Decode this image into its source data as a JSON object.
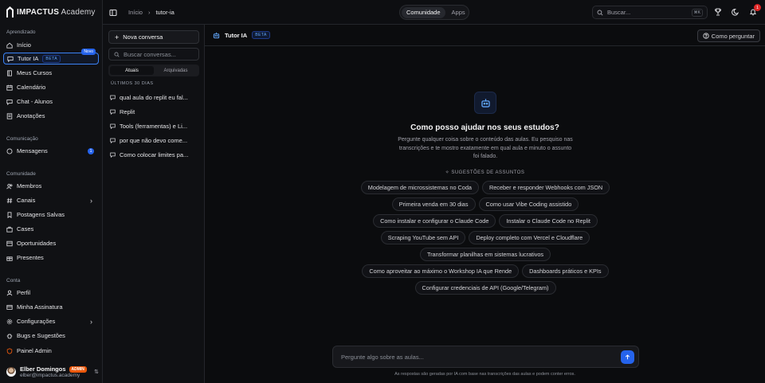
{
  "brand": {
    "name": "IMPACTUS",
    "suffix": " Academy"
  },
  "sidebar": {
    "sections": [
      {
        "label": "Aprendizado"
      },
      {
        "label": "Comunicação"
      },
      {
        "label": "Comunidade"
      },
      {
        "label": "Conta"
      }
    ],
    "items": [
      {
        "label": "Início",
        "icon": "home-icon"
      },
      {
        "label": "Tutor IA",
        "icon": "chat-icon",
        "badge": "BETA",
        "tag": "Novo",
        "active": true
      },
      {
        "label": "Meus Cursos",
        "icon": "book-icon"
      },
      {
        "label": "Calendário",
        "icon": "calendar-icon"
      },
      {
        "label": "Chat - Alunos",
        "icon": "chat-icon"
      },
      {
        "label": "Anotações",
        "icon": "note-icon"
      },
      {
        "label": "Mensagens",
        "icon": "message-icon",
        "count": "1"
      },
      {
        "label": "Membros",
        "icon": "users-icon"
      },
      {
        "label": "Canais",
        "icon": "hash-icon"
      },
      {
        "label": "Postagens Salvas",
        "icon": "bookmark-icon"
      },
      {
        "label": "Cases",
        "icon": "briefcase-icon"
      },
      {
        "label": "Oportunidades",
        "icon": "target-icon"
      },
      {
        "label": "Presentes",
        "icon": "gift-icon"
      },
      {
        "label": "Perfil",
        "icon": "user-icon"
      },
      {
        "label": "Minha Assinatura",
        "icon": "card-icon"
      },
      {
        "label": "Configurações",
        "icon": "gear-icon"
      },
      {
        "label": "Bugs e Sugestões",
        "icon": "bug-icon"
      },
      {
        "label": "Painel Admin",
        "icon": "shield-icon"
      }
    ],
    "user": {
      "name": "Elber Domingos",
      "role": "ADMIN",
      "email": "elber@impactus.academy"
    }
  },
  "topbar": {
    "breadcrumb": [
      "Início",
      "tutor-ia"
    ],
    "segments": [
      "Comunidade",
      "Apps"
    ],
    "search_placeholder": "Buscar...",
    "search_kbd": "⌘K",
    "notifications": "1"
  },
  "conversations": {
    "new_label": "Nova conversa",
    "search_placeholder": "Buscar conversas...",
    "tabs": [
      "Atuais",
      "Arquivadas"
    ],
    "group_label": "ÚLTIMOS 30 DIAS",
    "items": [
      "qual aula do replit eu fal...",
      "Replit",
      "Tools (ferramentas) e Li...",
      "por que não devo come...",
      "Como colocar limites pa..."
    ]
  },
  "main": {
    "title": "Tutor IA",
    "title_badge": "BETA",
    "how_label": "Como perguntar",
    "hero_title": "Como posso ajudar nos seus estudos?",
    "hero_sub": "Pergunte qualquer coisa sobre o conteúdo das aulas. Eu pesquiso nas transcrições e te mostro exatamente em qual aula e minuto o assunto foi falado.",
    "sugg_label": "SUGESTÕES DE ASSUNTOS",
    "suggestions": [
      "Modelagem de microssistemas no Coda",
      "Receber e responder Webhooks com JSON",
      "Primeira venda em 30 dias",
      "Como usar Vibe Coding assistido",
      "Como instalar e configurar o Claude Code",
      "Instalar o Claude Code no Replit",
      "Scraping YouTube sem API",
      "Deploy completo com Vercel e Cloudflare",
      "Transformar planilhas em sistemas lucrativos",
      "Como aproveitar ao máximo o Workshop IA que Rende",
      "Dashboards práticos e KPIs",
      "Configurar credenciais de API (Google/Telegram)"
    ],
    "composer_placeholder": "Pergunte algo sobre as aulas...",
    "disclaimer": "As respostas são geradas por IA com base nas transcrições das aulas e podem conter erros."
  },
  "colors": {
    "accent": "#2563eb",
    "active_border": "#3b82f6",
    "admin": "#ea580c",
    "alert": "#dc2626"
  }
}
